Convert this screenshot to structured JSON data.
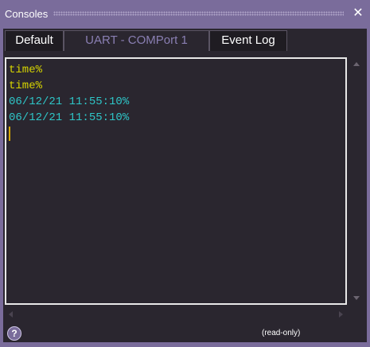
{
  "window": {
    "title": "Consoles",
    "close_glyph": "✕"
  },
  "tabs": [
    {
      "label": "Default",
      "active": false
    },
    {
      "label": "UART - COMPort 1",
      "active": true
    },
    {
      "label": "Event Log",
      "active": false
    }
  ],
  "console": {
    "lines": [
      {
        "text": "time%",
        "color": "#d6d400"
      },
      {
        "text": "time%",
        "color": "#d6d400"
      },
      {
        "text": "06/12/21 11:55:10%",
        "color": "#2ec6c8"
      },
      {
        "text": "06/12/21 11:55:10%",
        "color": "#2ec6c8"
      }
    ]
  },
  "statusbar": {
    "help_glyph": "?",
    "mode_text": "(read-only)"
  },
  "colors": {
    "window_chrome": "#7a6c9b",
    "panel_background": "#2a262f",
    "active_tab_text": "#8a7fb3",
    "console_border": "#e8e8e8",
    "cursor": "#d6a800"
  },
  "icons": {
    "close": "close-icon",
    "help": "help-icon",
    "scroll_up": "arrow-up-icon",
    "scroll_down": "arrow-down-icon",
    "scroll_left": "arrow-left-icon",
    "scroll_right": "arrow-right-icon"
  }
}
